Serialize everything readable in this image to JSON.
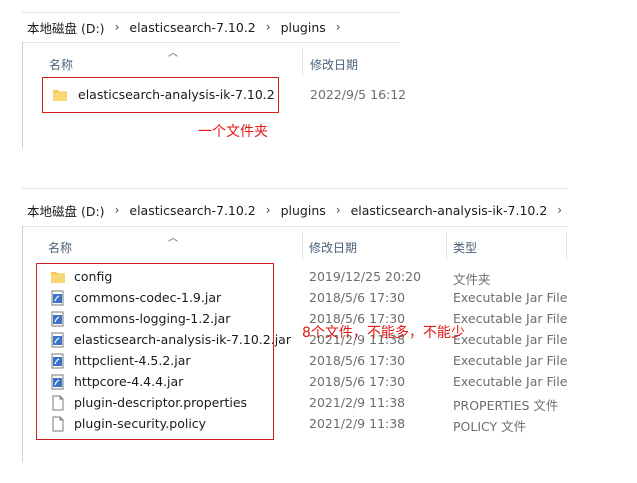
{
  "top": {
    "breadcrumb": [
      "本地磁盘 (D:)",
      "elasticsearch-7.10.2",
      "plugins"
    ],
    "columns": {
      "name": "名称",
      "modified": "修改日期"
    },
    "rows": [
      {
        "name": "elasticsearch-analysis-ik-7.10.2",
        "modified": "2022/9/5 16:12",
        "icon": "folder-icon"
      }
    ],
    "annotation": "一个文件夹"
  },
  "bottom": {
    "breadcrumb": [
      "本地磁盘 (D:)",
      "elasticsearch-7.10.2",
      "plugins",
      "elasticsearch-analysis-ik-7.10.2"
    ],
    "columns": {
      "name": "名称",
      "modified": "修改日期",
      "type": "类型"
    },
    "rows": [
      {
        "name": "config",
        "modified": "2019/12/25 20:20",
        "type": "文件夹",
        "icon": "folder-icon"
      },
      {
        "name": "commons-codec-1.9.jar",
        "modified": "2018/5/6 17:30",
        "type": "Executable Jar File",
        "icon": "jar-icon"
      },
      {
        "name": "commons-logging-1.2.jar",
        "modified": "2018/5/6 17:30",
        "type": "Executable Jar File",
        "icon": "jar-icon"
      },
      {
        "name": "elasticsearch-analysis-ik-7.10.2.jar",
        "modified": "2021/2/9 11:38",
        "type": "Executable Jar File",
        "icon": "jar-icon"
      },
      {
        "name": "httpclient-4.5.2.jar",
        "modified": "2018/5/6 17:30",
        "type": "Executable Jar File",
        "icon": "jar-icon"
      },
      {
        "name": "httpcore-4.4.4.jar",
        "modified": "2018/5/6 17:30",
        "type": "Executable Jar File",
        "icon": "jar-icon"
      },
      {
        "name": "plugin-descriptor.properties",
        "modified": "2021/2/9 11:38",
        "type": "PROPERTIES 文件",
        "icon": "file-icon"
      },
      {
        "name": "plugin-security.policy",
        "modified": "2021/2/9 11:38",
        "type": "POLICY 文件",
        "icon": "file-icon"
      }
    ],
    "annotation": "8个文件，不能多，不能少"
  },
  "colors": {
    "annotation": "#e01818",
    "header": "#4c607a",
    "folder": "#f3c94f"
  }
}
